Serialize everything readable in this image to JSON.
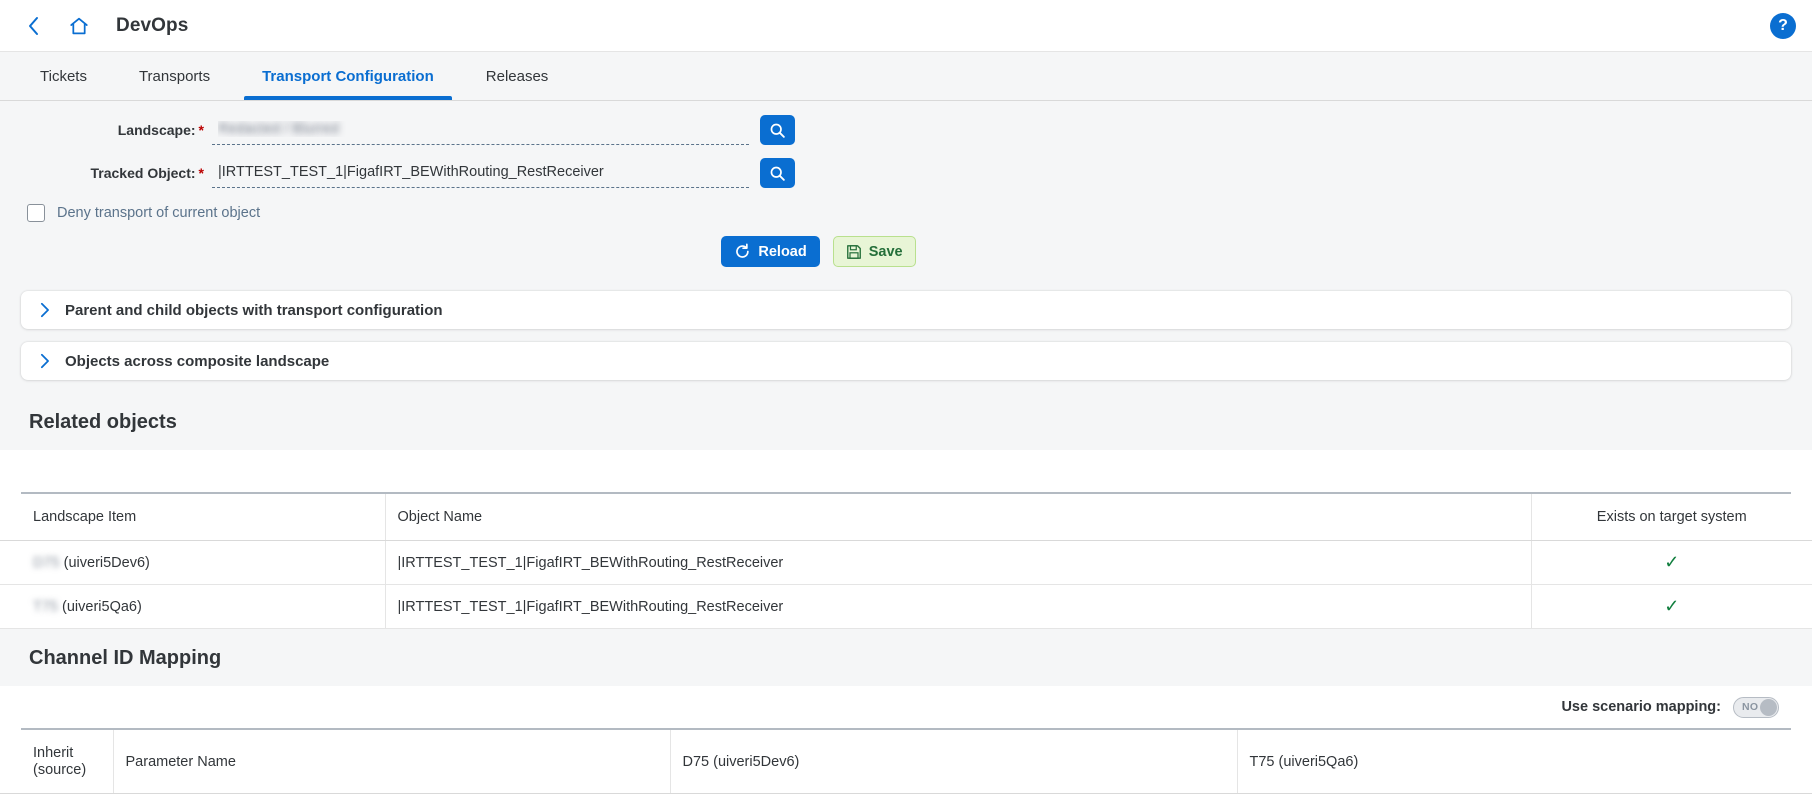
{
  "header": {
    "back_icon": "chevron-left-icon",
    "home_icon": "home-icon",
    "title": "DevOps",
    "help_icon": "question-mark-icon",
    "accent_color": "#0a6ed1"
  },
  "tabs": [
    {
      "label": "Tickets",
      "selected": false
    },
    {
      "label": "Transports",
      "selected": false
    },
    {
      "label": "Transport Configuration",
      "selected": true
    },
    {
      "label": "Releases",
      "selected": false
    }
  ],
  "form": {
    "landscape": {
      "label": "Landscape:",
      "required": "*",
      "value": "Redacted / Blurred",
      "placeholder": "",
      "search_icon": "search-icon"
    },
    "tracked_object": {
      "label": "Tracked Object:",
      "required": "*",
      "value": "|IRTTEST_TEST_1|FigafIRT_BEWithRouting_RestReceiver",
      "placeholder": "",
      "search_icon": "search-icon"
    },
    "deny_transport": {
      "label": "Deny transport of current object",
      "checked": false
    },
    "buttons": {
      "reload": {
        "label": "Reload",
        "icon": "refresh-icon",
        "color": "#0a6ed1"
      },
      "save": {
        "label": "Save",
        "icon": "floppy-disk-icon",
        "color": "#e8f5d6"
      }
    }
  },
  "panels": [
    {
      "title": "Parent and child objects with transport configuration",
      "icon": "chevron-right-icon",
      "expanded": false
    },
    {
      "title": "Objects across composite landscape",
      "icon": "chevron-right-icon",
      "expanded": false
    }
  ],
  "related_objects": {
    "section_title": "Related objects",
    "columns": [
      "Landscape Item",
      "Object Name",
      "Exists on target system"
    ],
    "rows": [
      {
        "landscape_item_masked": "D75",
        "landscape_item_suffix": " (uiveri5Dev6)",
        "object_name": "|IRTTEST_TEST_1|FigafIRT_BEWithRouting_RestReceiver",
        "exists_icon": "check-icon",
        "exists_color": "#107e3e"
      },
      {
        "landscape_item_masked": "T75",
        "landscape_item_suffix": " (uiveri5Qa6)",
        "object_name": "|IRTTEST_TEST_1|FigafIRT_BEWithRouting_RestReceiver",
        "exists_icon": "check-icon",
        "exists_color": "#107e3e"
      }
    ]
  },
  "channel_id_mapping": {
    "section_title": "Channel ID Mapping",
    "use_scenario_mapping": {
      "label": "Use scenario mapping:",
      "value": "NO"
    },
    "columns": [
      "Inherit (source)",
      "Parameter Name",
      "D75 (uiveri5Dev6)",
      "T75 (uiveri5Qa6)"
    ]
  }
}
